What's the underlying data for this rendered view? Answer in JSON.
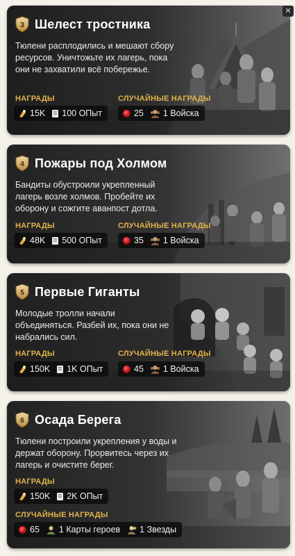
{
  "quests": [
    {
      "number": "3",
      "title": "Шелест тростника",
      "description": "Тюлени расплодились и мешают сбору ресурсов. Уничтожьте их лагерь, пока они не захватили всё побережье.",
      "rewards_label": "НАГРАДЫ",
      "random_rewards_label": "СЛУЧАЙНЫЕ НАГРАДЫ",
      "rewards": [
        {
          "icon": "food-icon",
          "text": "15K"
        },
        {
          "icon": "xp-book-icon",
          "text": "100 ОПыт"
        }
      ],
      "random_rewards": [
        {
          "icon": "ruby-icon",
          "text": "25"
        },
        {
          "icon": "troops-icon",
          "text": "1 Войска"
        }
      ]
    },
    {
      "number": "4",
      "title": "Пожары под Холмом",
      "description": "Бандиты обустроили укрепленный лагерь возле холмов. Пробейте их оборону и сожгите аванпост дотла.",
      "rewards_label": "НАГРАДЫ",
      "random_rewards_label": "СЛУЧАЙНЫЕ НАГРАДЫ",
      "rewards": [
        {
          "icon": "food-icon",
          "text": "48K"
        },
        {
          "icon": "xp-book-icon",
          "text": "500 ОПыт"
        }
      ],
      "random_rewards": [
        {
          "icon": "ruby-icon",
          "text": "35"
        },
        {
          "icon": "troops-icon",
          "text": "1 Войска"
        }
      ]
    },
    {
      "number": "5",
      "title": "Первые Гиганты",
      "description": "Молодые тролли начали объединяться. Разбей их, пока они не набрались сил.",
      "rewards_label": "НАГРАДЫ",
      "random_rewards_label": "СЛУЧАЙНЫЕ НАГРАДЫ",
      "rewards": [
        {
          "icon": "food-icon",
          "text": "150K"
        },
        {
          "icon": "xp-book-icon",
          "text": "1K ОПыт"
        }
      ],
      "random_rewards": [
        {
          "icon": "ruby-icon",
          "text": "45"
        },
        {
          "icon": "troops-icon",
          "text": "1 Войска"
        }
      ]
    },
    {
      "number": "6",
      "title": "Осада Берега",
      "description": "Тюлени построили укрепления у воды и держат оборону. Прорвитесь через их лагерь и очистите берег.",
      "rewards_label": "НАГРАДЫ",
      "random_rewards_label": "СЛУЧАЙНЫЕ НАГРАДЫ",
      "rewards": [
        {
          "icon": "food-icon",
          "text": "150K"
        },
        {
          "icon": "xp-book-icon",
          "text": "2K ОПыт"
        }
      ],
      "random_rewards": [
        {
          "icon": "ruby-icon",
          "text": "65"
        },
        {
          "icon": "hero-cards-icon",
          "text": "1 Карты героев"
        },
        {
          "icon": "stars-icon",
          "text": "1 Звезды"
        }
      ]
    }
  ],
  "colors": {
    "label_gold": "#e3b24a",
    "card_dark": "#2b2b2b",
    "ruby": "#d4202a"
  }
}
